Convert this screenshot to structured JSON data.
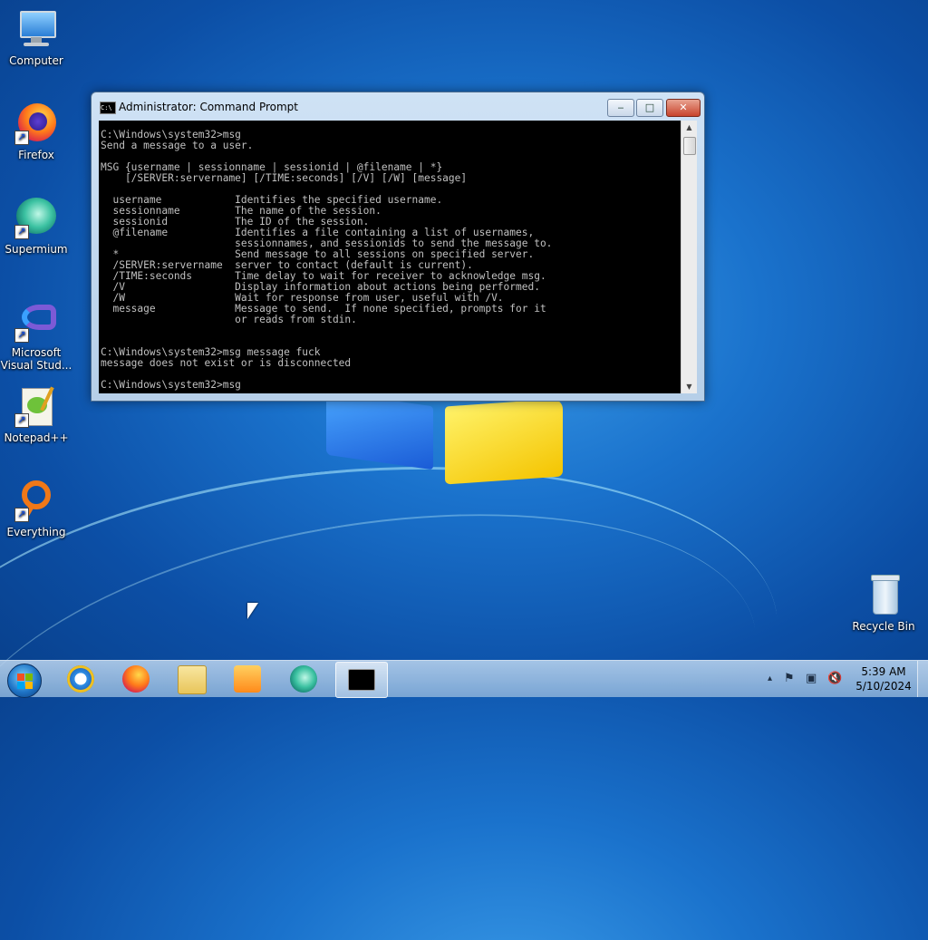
{
  "desktop": {
    "icons": [
      {
        "label": "Computer"
      },
      {
        "label": "Firefox"
      },
      {
        "label": "Supermium"
      },
      {
        "label": "Microsoft Visual Stud..."
      },
      {
        "label": "Notepad++"
      },
      {
        "label": "Everything"
      },
      {
        "label": "Recycle Bin"
      }
    ]
  },
  "window": {
    "title": "Administrator: Command Prompt",
    "icon_text": "C:\\",
    "controls": {
      "minimize": "‒",
      "maximize": "□",
      "close": "✕"
    },
    "console_text": "C:\\Windows\\system32>msg\nSend a message to a user.\n\nMSG {username | sessionname | sessionid | @filename | *}\n    [/SERVER:servername] [/TIME:seconds] [/V] [/W] [message]\n\n  username            Identifies the specified username.\n  sessionname         The name of the session.\n  sessionid           The ID of the session.\n  @filename           Identifies a file containing a list of usernames,\n                      sessionnames, and sessionids to send the message to.\n  *                   Send message to all sessions on specified server.\n  /SERVER:servername  server to contact (default is current).\n  /TIME:seconds       Time delay to wait for receiver to acknowledge msg.\n  /V                  Display information about actions being performed.\n  /W                  Wait for response from user, useful with /V.\n  message             Message to send.  If none specified, prompts for it\n                      or reads from stdin.\n\n\nC:\\Windows\\system32>msg message fuck\nmessage does not exist or is disconnected\n\nC:\\Windows\\system32>msg"
  },
  "taskbar": {
    "pinned": [
      {
        "name": "Internet Explorer"
      },
      {
        "name": "Firefox"
      },
      {
        "name": "Windows Explorer"
      },
      {
        "name": "Windows Media Player"
      },
      {
        "name": "Supermium"
      },
      {
        "name": "Command Prompt",
        "active": true
      }
    ],
    "tray": {
      "show_hidden": "▴",
      "flag": "⚑",
      "network": "▣",
      "volume": "🔇"
    },
    "clock": {
      "time": "5:39 AM",
      "date": "5/10/2024"
    }
  },
  "colors": {
    "console_bg": "#000000",
    "console_fg": "#c0c0c0",
    "close_button": "#c8442c"
  }
}
